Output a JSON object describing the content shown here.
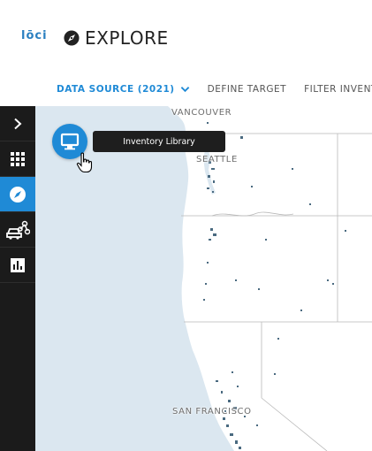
{
  "app": {
    "logo_text": "lōci",
    "title": "EXPLORE",
    "title_icon": "compass-icon"
  },
  "tabs": [
    {
      "label": "DATA SOURCE (2021)",
      "active": true,
      "has_dropdown": true
    },
    {
      "label": "DEFINE TARGET",
      "active": false
    },
    {
      "label": "FILTER INVENTORY",
      "active": false
    }
  ],
  "sidebar": {
    "items": [
      {
        "icon": "chevron-right-icon",
        "active": false
      },
      {
        "icon": "grid-icon",
        "active": false
      },
      {
        "icon": "compass-icon",
        "active": true
      },
      {
        "icon": "vehicle-network-icon",
        "active": false
      },
      {
        "icon": "bar-chart-icon",
        "active": false
      }
    ]
  },
  "map": {
    "cities": [
      "VANCOUVER",
      "SEATTLE",
      "SAN FRANCISCO"
    ]
  },
  "inventory_button": {
    "icon": "monitor-icon",
    "tooltip": "Inventory Library"
  },
  "colors": {
    "accent": "#1f8ad6",
    "sidebar_bg": "#1b1b1b",
    "ocean": "#dbe7f0",
    "land": "#ffffff"
  }
}
